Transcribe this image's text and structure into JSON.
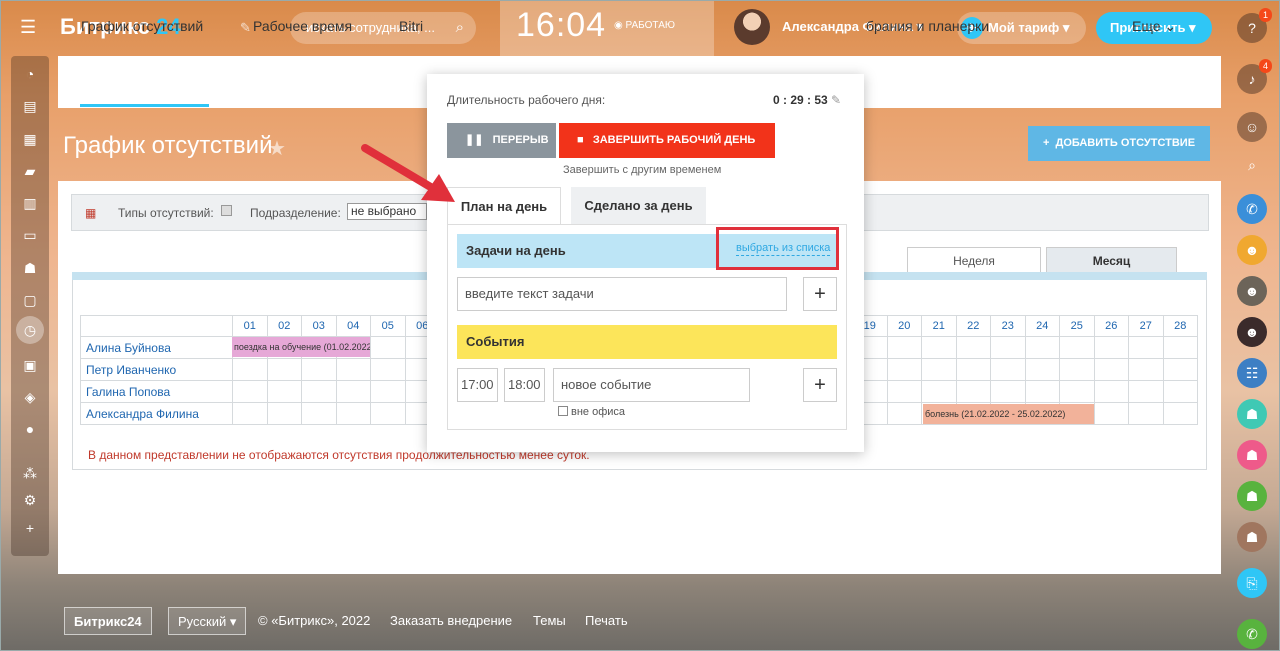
{
  "header": {
    "logo_main": "Битрикс",
    "logo_num": "24",
    "search_placeholder": "искать сотрудника, ...",
    "clock": "16:04",
    "work_status": "РАБОТАЮ",
    "user_name": "Александра Филина",
    "tariff": "Мой тариф",
    "invite": "Пригласить"
  },
  "right_rail": {
    "help_badge": "1",
    "notify_badge": "4"
  },
  "tabs": [
    {
      "label": "График отсутствий"
    },
    {
      "label": "Рабочее время"
    },
    {
      "label": "Bitri"
    },
    {
      "label": "брания и планерки"
    },
    {
      "label": "Еще"
    }
  ],
  "page": {
    "title": "График отсутствий",
    "add_button": "ДОБАВИТЬ ОТСУТСТВИЕ"
  },
  "filters": {
    "types_label": "Типы отсутствий:",
    "dept_label": "Подразделение:",
    "dept_value": "не выбрано"
  },
  "view_tabs": [
    "Неделя",
    "Месяц"
  ],
  "calendar": {
    "days_left": [
      "01",
      "02",
      "03",
      "04",
      "05",
      "06"
    ],
    "days_right": [
      "19",
      "20",
      "21",
      "22",
      "23",
      "24",
      "25",
      "26",
      "27",
      "28"
    ],
    "employees": [
      "Алина Буйнова",
      "Петр Иванченко",
      "Галина Попова",
      "Александра Филина"
    ],
    "events": [
      {
        "text": "поездка на обучение (01.02.2022",
        "color": "#e6a8d7"
      },
      {
        "text": "болезнь (21.02.2022 - 25.02.2022)",
        "color": "#f2b29a"
      }
    ],
    "note": "В данном представлении не отображаются отсутствия продолжительностью менее суток."
  },
  "popup": {
    "duration_label": "Длительность рабочего дня:",
    "duration_value": "0 : 29 : 53",
    "pause": "ПЕРЕРЫВ",
    "end_day": "ЗАВЕРШИТЬ РАБОЧИЙ ДЕНЬ",
    "end_other": "Завершить с другим временем",
    "tab_plan": "План на день",
    "tab_done": "Сделано за день",
    "tasks_header": "Задачи на день",
    "pick_from_list": "выбрать из списка",
    "task_placeholder": "введите текст задачи",
    "events_header": "События",
    "time_from": "17:00",
    "time_to": "18:00",
    "event_placeholder": "новое событие",
    "out_of_office": "вне офиса"
  },
  "footer": {
    "brand": "Битрикс24",
    "language": "Русский",
    "copyright": "© «Битрикс», 2022",
    "order": "Заказать внедрение",
    "themes": "Темы",
    "print": "Печать"
  }
}
